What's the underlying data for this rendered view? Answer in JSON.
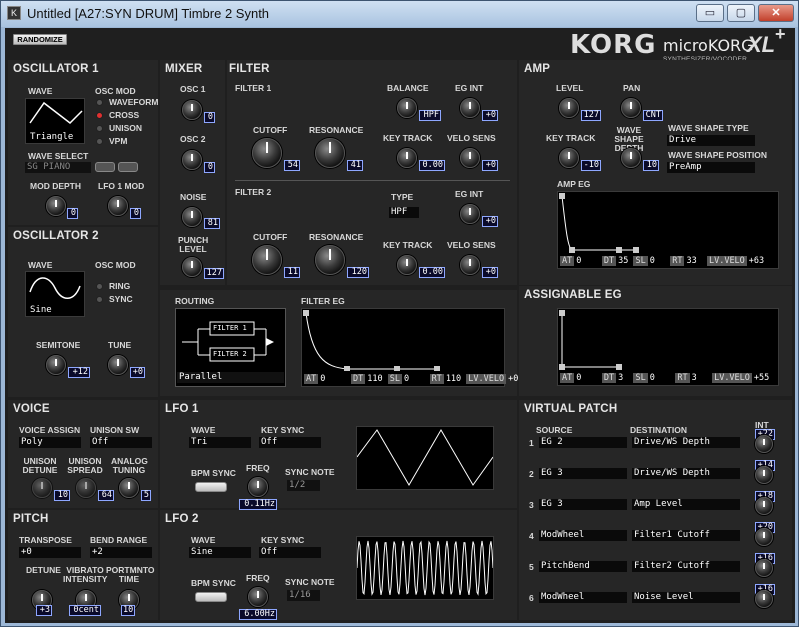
{
  "window": {
    "title": "Untitled [A27:SYN DRUM] Timbre 2 Synth",
    "minimize": "▭",
    "maximize": "▢",
    "close": "✕"
  },
  "brand": {
    "korg": "KORG",
    "model": "microKORG",
    "xl": "XL",
    "plus": "+",
    "subtitle": "SYNTHESIZER/VOCODER",
    "randomize": "RANDOMIZE"
  },
  "osc1": {
    "title": "OSCILLATOR 1",
    "wave_label": "WAVE",
    "wave": "Triangle",
    "osc_mod_label": "OSC MOD",
    "mods": [
      "WAVEFORM",
      "CROSS",
      "UNISON",
      "VPM"
    ],
    "wave_select_label": "WAVE SELECT",
    "wave_select": "SG PIANO",
    "mod_depth_label": "MOD DEPTH",
    "mod_depth": "0",
    "lfo1_mod_label": "LFO 1 MOD",
    "lfo1_mod": "0"
  },
  "osc2": {
    "title": "OSCILLATOR 2",
    "wave_label": "WAVE",
    "wave": "Sine",
    "osc_mod_label": "OSC MOD",
    "mods": [
      "RING",
      "SYNC"
    ],
    "semitone_label": "SEMITONE",
    "semitone": "+12",
    "tune_label": "TUNE",
    "tune": "+0"
  },
  "mixer": {
    "title": "MIXER",
    "osc1_label": "OSC 1",
    "osc1": "0",
    "osc2_label": "OSC 2",
    "osc2": "0",
    "noise_label": "NOISE",
    "noise": "81",
    "punch_label": "PUNCH LEVEL",
    "punch": "127"
  },
  "filter": {
    "title": "FILTER",
    "f1_label": "FILTER 1",
    "cutoff_label": "CUTOFF",
    "f1_cutoff": "54",
    "resonance_label": "RESONANCE",
    "f1_res": "41",
    "balance_label": "BALANCE",
    "balance": "HPF",
    "egint_label": "EG INT",
    "f1_egint": "+0",
    "keytrack_label": "KEY TRACK",
    "f1_keytrack": "0.00",
    "velo_label": "VELO SENS",
    "f1_velo": "+0",
    "f2_label": "FILTER 2",
    "type_label": "TYPE",
    "f2_type": "HPF",
    "f2_egint": "+0",
    "f2_cutoff": "11",
    "f2_res": "120",
    "f2_keytrack": "0.00",
    "f2_velo": "+0"
  },
  "routing": {
    "title": "ROUTING",
    "f1": "FILTER 1",
    "f2": "FILTER 2",
    "mode": "Parallel"
  },
  "filter_eg": {
    "title": "FILTER EG",
    "at": "0",
    "dt": "110",
    "sl": "0",
    "rt": "110",
    "lvvelo": "+0"
  },
  "eg_tags": {
    "at": "AT",
    "dt": "DT",
    "sl": "SL",
    "rt": "RT",
    "lv": "LV.VELO"
  },
  "amp": {
    "title": "AMP",
    "level_label": "LEVEL",
    "level": "127",
    "pan_label": "PAN",
    "pan": "CNT",
    "keytrack_label": "KEY TRACK",
    "keytrack": "-10",
    "wsdepth_label": "WAVE SHAPE DEPTH",
    "wsdepth": "10",
    "wstype_label": "WAVE SHAPE TYPE",
    "wstype": "Drive",
    "wspos_label": "WAVE SHAPE POSITION",
    "wspos": "PreAmp",
    "eg_label": "AMP EG",
    "at": "0",
    "dt": "35",
    "sl": "0",
    "rt": "33",
    "lvvelo": "+63"
  },
  "assign_eg": {
    "title": "ASSIGNABLE EG",
    "at": "0",
    "dt": "3",
    "sl": "0",
    "rt": "3",
    "lvvelo": "+55"
  },
  "voice": {
    "title": "VOICE",
    "assign_label": "VOICE ASSIGN",
    "assign": "Poly",
    "unisonsw_label": "UNISON SW",
    "unisonsw": "Off",
    "detune_label": "UNISON DETUNE",
    "detune": "10",
    "spread_label": "UNISON SPREAD",
    "spread": "64",
    "analog_label": "ANALOG TUNING",
    "analog": "5"
  },
  "pitch": {
    "title": "PITCH",
    "transpose_label": "TRANSPOSE",
    "transpose": "+0",
    "bend_label": "BEND RANGE",
    "bend": "+2",
    "detune_label": "DETUNE",
    "detune": "+3",
    "vib_label": "VIBRATO INTENSITY",
    "vib": "0cent",
    "porta_label": "PORTMNTO TIME",
    "porta": "10"
  },
  "lfo1": {
    "title": "LFO 1",
    "wave_label": "WAVE",
    "wave": "Tri",
    "keysync_label": "KEY SYNC",
    "keysync": "Off",
    "bpm_label": "BPM SYNC",
    "freq_label": "FREQ",
    "freq": "0.11Hz",
    "note_label": "SYNC NOTE",
    "note": "1/2"
  },
  "lfo2": {
    "title": "LFO 2",
    "wave_label": "WAVE",
    "wave": "Sine",
    "keysync_label": "KEY SYNC",
    "keysync": "Off",
    "bpm_label": "BPM SYNC",
    "freq_label": "FREQ",
    "freq": "6.00Hz",
    "note_label": "SYNC NOTE",
    "note": "1/16"
  },
  "vpatch": {
    "title": "VIRTUAL PATCH",
    "source_label": "SOURCE",
    "dest_label": "DESTINATION",
    "int_label": "INT",
    "rows": [
      {
        "n": "1",
        "src": "EG 2",
        "dst": "Drive/WS Depth",
        "int": "+22"
      },
      {
        "n": "2",
        "src": "EG 3",
        "dst": "Drive/WS Depth",
        "int": "+14"
      },
      {
        "n": "3",
        "src": "EG 3",
        "dst": "Amp Level",
        "int": "+18"
      },
      {
        "n": "4",
        "src": "ModWheel",
        "dst": "Filter1 Cutoff",
        "int": "+20"
      },
      {
        "n": "5",
        "src": "PitchBend",
        "dst": "Filter2 Cutoff",
        "int": "+16"
      },
      {
        "n": "6",
        "src": "ModWheel",
        "dst": "Noise Level",
        "int": "+16"
      }
    ]
  }
}
